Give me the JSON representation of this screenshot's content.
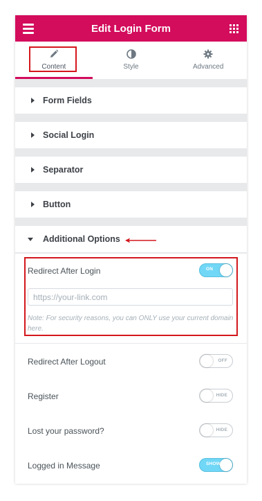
{
  "header": {
    "title": "Edit Login Form",
    "menu_icon": "hamburger-icon",
    "apps_icon": "grid-icon",
    "color": "#d30c5c"
  },
  "tabs": [
    {
      "label": "Content",
      "icon": "pencil-icon",
      "active": true
    },
    {
      "label": "Style",
      "icon": "half-circle-icon",
      "active": false
    },
    {
      "label": "Advanced",
      "icon": "gear-icon",
      "active": false
    }
  ],
  "sections": [
    {
      "label": "Form Fields",
      "expanded": false
    },
    {
      "label": "Social Login",
      "expanded": false
    },
    {
      "label": "Separator",
      "expanded": false
    },
    {
      "label": "Button",
      "expanded": false
    },
    {
      "label": "Additional Options",
      "expanded": true
    }
  ],
  "options": {
    "redirect_after_login": {
      "label": "Redirect After Login",
      "toggle": "ON",
      "state": true
    },
    "url": {
      "placeholder": "https://your-link.com",
      "value": ""
    },
    "note": "Note: For security reasons, you can ONLY use your current domain here.",
    "redirect_after_logout": {
      "label": "Redirect After Logout",
      "toggle": "OFF",
      "state": false
    },
    "register": {
      "label": "Register",
      "toggle": "HIDE",
      "state": false
    },
    "lost_password": {
      "label": "Lost your password?",
      "toggle": "HIDE",
      "state": false
    },
    "logged_in_message": {
      "label": "Logged in Message",
      "toggle": "SHOW",
      "state": true
    }
  },
  "annotation_color": "#d3161c"
}
